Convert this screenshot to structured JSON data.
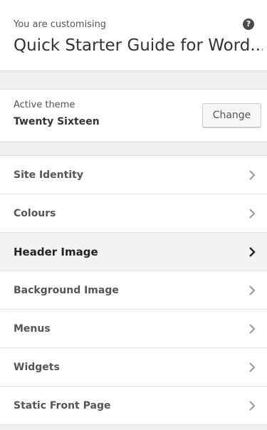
{
  "info": {
    "customising_label": "You are customising",
    "site_title": "Quick Starter Guide for Word...",
    "help_icon": "help-question-icon"
  },
  "theme": {
    "label": "Active theme",
    "name": "Twenty Sixteen",
    "change_label": "Change"
  },
  "sections": [
    {
      "label": "Site Identity",
      "active": false
    },
    {
      "label": "Colours",
      "active": false
    },
    {
      "label": "Header Image",
      "active": true
    },
    {
      "label": "Background Image",
      "active": false
    },
    {
      "label": "Menus",
      "active": false
    },
    {
      "label": "Widgets",
      "active": false
    },
    {
      "label": "Static Front Page",
      "active": false
    }
  ],
  "colors": {
    "chevron": "#999999",
    "chevron_active": "#222222",
    "active_bg": "#f3f3f3"
  }
}
